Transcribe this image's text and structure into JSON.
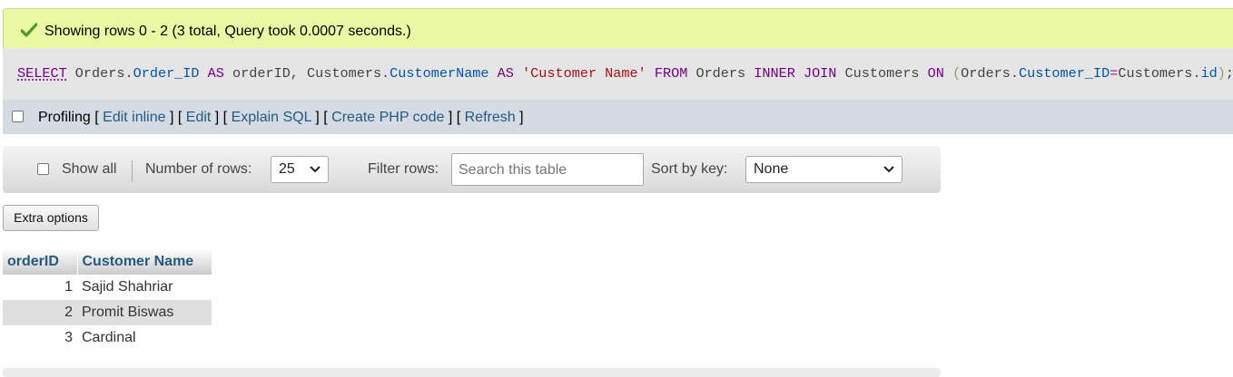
{
  "status": {
    "message": "Showing rows 0 - 2 (3 total, Query took 0.0007 seconds.)",
    "icon": "checkmark-icon",
    "background": "#ebf8a4"
  },
  "sql": {
    "t1": "SELECT",
    "t2": " Orders.",
    "t3": "Order_ID",
    "t4": " ",
    "t5": "AS",
    "t6": " orderID, Customers.",
    "t7": "CustomerName",
    "t8": " ",
    "t9": "AS",
    "t10": " ",
    "t11": "'Customer Name'",
    "t12": " ",
    "t13": "FROM",
    "t14": " Orders ",
    "t15": "INNER JOIN",
    "t16": " Customers ",
    "t17": "ON",
    "t18": " ",
    "t19": "(",
    "t20": "Orders.",
    "t21": "Customer_ID",
    "t22": "=",
    "t23": "Customers.",
    "t24": "id",
    "t25": ")",
    "t26": ";"
  },
  "profiling": {
    "label": "Profiling",
    "br1": " [ ",
    "edit_inline": "Edit inline",
    "br2": " ] [ ",
    "edit": "Edit",
    "br3": " ] [ ",
    "explain": "Explain SQL",
    "br4": " ] [ ",
    "create_php": "Create PHP code",
    "br5": " ] [ ",
    "refresh": "Refresh",
    "br6": " ]",
    "checked": false
  },
  "navbar": {
    "show_all": "Show all",
    "num_rows_label": "Number of rows:",
    "num_rows_value": "25",
    "filter_label": "Filter rows:",
    "filter_placeholder": "Search this table",
    "sort_label": "Sort by key:",
    "sort_value": "None"
  },
  "extra_options": "Extra options",
  "table": {
    "columns": [
      "orderID",
      "Customer Name"
    ],
    "rows": [
      [
        "1",
        "Sajid Shahriar"
      ],
      [
        "2",
        "Promit Biswas"
      ],
      [
        "3",
        "Cardinal"
      ]
    ]
  },
  "colors": {
    "link": "#235a81",
    "sql_bg": "#e5e5e5",
    "profiling_bg": "#d5dbe3",
    "row_even": "#dfdfdf"
  }
}
